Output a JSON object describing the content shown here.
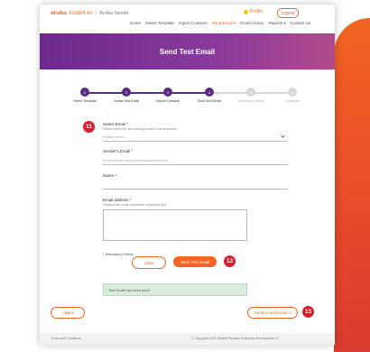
{
  "header": {
    "logo": "aruba",
    "product": "instant on",
    "separator": "|",
    "subtitle": "Aruba Sendit",
    "profile": "Profile",
    "logout": "Logout",
    "nav": [
      "Home",
      "Select Template",
      "Import Contacts",
      "Send Email ▾",
      "Email Library",
      "Reports ▾",
      "Contact Us"
    ],
    "active_nav_index": 3
  },
  "hero": {
    "title": "Send Test Email"
  },
  "stepper": {
    "steps": [
      {
        "label": "Select Template",
        "num": "1",
        "done": true
      },
      {
        "label": "Create Test Email",
        "num": "2",
        "done": true
      },
      {
        "label": "Import Contacts",
        "num": "3",
        "done": true
      },
      {
        "label": "Send Test Email",
        "num": "4",
        "done": true
      },
      {
        "label": "Send Actual Email",
        "num": "5",
        "done": false
      },
      {
        "label": "Complete",
        "num": "6",
        "done": false
      }
    ],
    "colors": {
      "done": "#5b2c83",
      "todo": "#d7d7d7"
    }
  },
  "form": {
    "select_label": "Select Email",
    "select_hint": "Please select the sub pending email in the dropdown",
    "select_placeholder": "Please select",
    "sender_label": "Sender's Email",
    "sender_value": "aruba-sendit-noreply@aruba-sendit.com",
    "name_label": "Name",
    "email_label": "Email address",
    "email_hint": "Please enter email addresses separated by a \",\"",
    "req": "*",
    "mandatory": "* Mandatory Fields"
  },
  "buttons": {
    "clear": "Clear",
    "send_test": "Send Test Email",
    "back": "< Back",
    "send_actual": "Send Actual Email >"
  },
  "success_message": "Test Email has been sent!",
  "badges": {
    "select": "11",
    "send_test": "12",
    "send_actual": "13"
  },
  "footer": {
    "left": "Terms and Conditions",
    "right": "© Copyright 2022 Hewlett Packard Enterprise Development LP"
  },
  "colors": {
    "accent": "#f26522",
    "purple": "#6c2a8c",
    "badge": "#d8202c",
    "success_bg": "#d9ecdc"
  }
}
